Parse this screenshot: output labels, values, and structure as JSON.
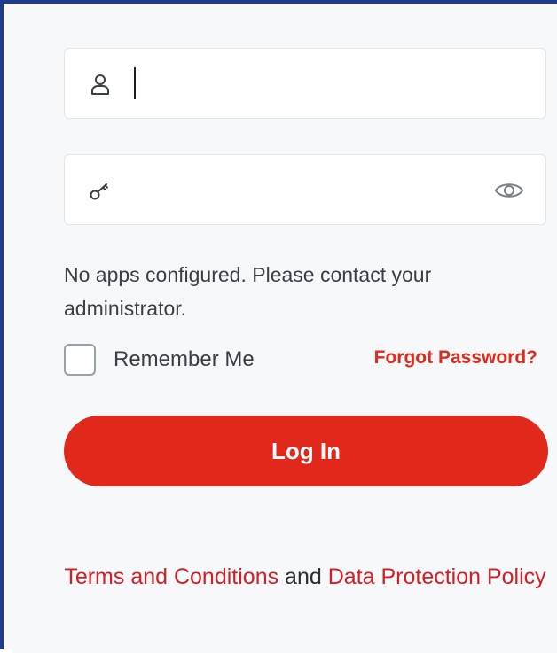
{
  "username": {
    "icon": "user-icon",
    "value": "",
    "placeholder": ""
  },
  "password": {
    "icon": "key-icon",
    "value": "",
    "placeholder": "",
    "toggle_icon": "eye-icon"
  },
  "message": "No apps configured. Please contact your administrator.",
  "remember": {
    "label": "Remember Me",
    "checked": false
  },
  "forgot_label": "Forgot Password?",
  "login_label": "Log In",
  "footer": {
    "terms_label": "Terms and Conditions",
    "and_text": " and ",
    "policy_label": "Data Protection Policy"
  },
  "colors": {
    "accent": "#e0291a",
    "link": "#d11f25",
    "frame": "#1f3c88"
  }
}
